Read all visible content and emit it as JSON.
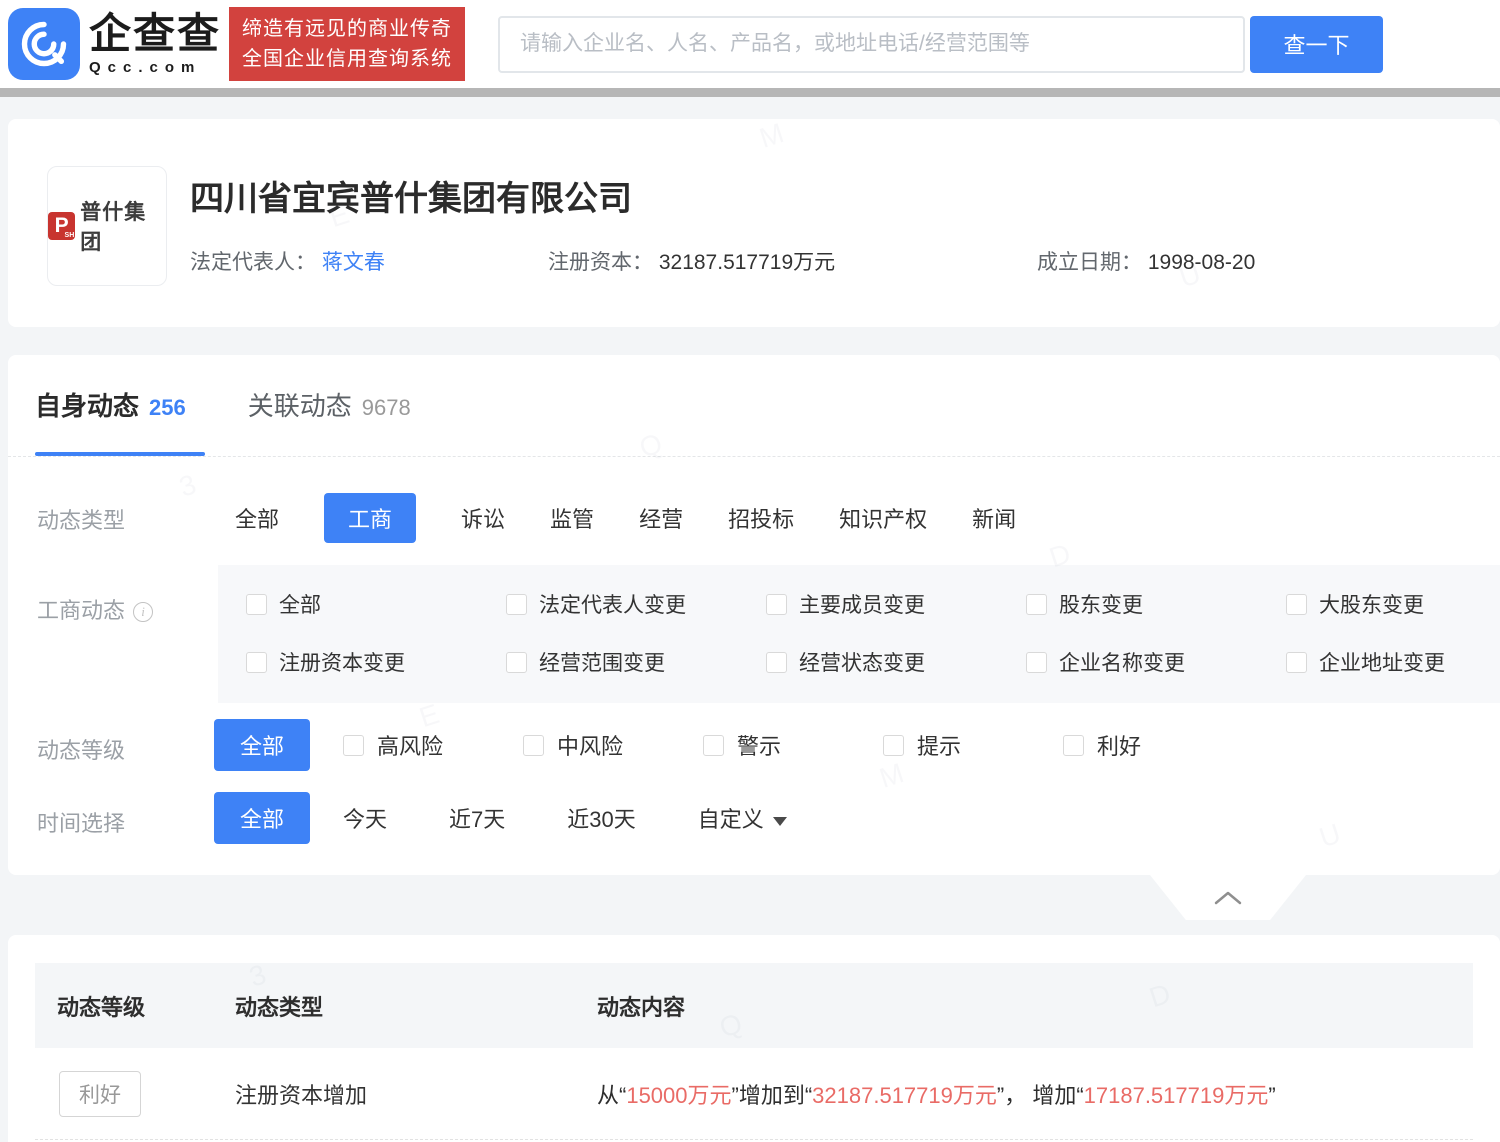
{
  "brand": {
    "name": "企查查",
    "domain": "Qcc.com",
    "slogan_line1": "缔造有远见的商业传奇",
    "slogan_line2": "全国企业信用查询系统"
  },
  "search": {
    "placeholder": "请输入企业名、人名、产品名，或地址电话/经营范围等",
    "button_label": "查一下"
  },
  "company": {
    "logo_letter": "P",
    "logo_sub": "SH",
    "logo_text": "普什集团",
    "name": "四川省宜宾普什集团有限公司",
    "legal_rep_label": "法定代表人：",
    "legal_rep": "蒋文春",
    "reg_capital_label": "注册资本：",
    "reg_capital": "32187.517719万元",
    "established_label": "成立日期：",
    "established": "1998-08-20"
  },
  "tabs": {
    "self": {
      "label": "自身动态",
      "count": "256"
    },
    "related": {
      "label": "关联动态",
      "count": "9678"
    }
  },
  "filters": {
    "type": {
      "label": "动态类型",
      "options": [
        "全部",
        "工商",
        "诉讼",
        "监管",
        "经营",
        "招投标",
        "知识产权",
        "新闻"
      ],
      "selected": "工商"
    },
    "biz_changes": {
      "label": "工商动态",
      "row1": [
        "全部",
        "法定代表人变更",
        "主要成员变更",
        "股东变更",
        "大股东变更"
      ],
      "row2": [
        "注册资本变更",
        "经营范围变更",
        "经营状态变更",
        "企业名称变更",
        "企业地址变更"
      ]
    },
    "level": {
      "label": "动态等级",
      "all_label": "全部",
      "options": [
        "高风险",
        "中风险",
        "警示",
        "提示",
        "利好"
      ]
    },
    "time": {
      "label": "时间选择",
      "all_label": "全部",
      "options": [
        "今天",
        "近7天",
        "近30天"
      ],
      "custom_label": "自定义"
    }
  },
  "table": {
    "headers": [
      "动态等级",
      "动态类型",
      "动态内容"
    ],
    "rows": [
      {
        "level": "利好",
        "type": "注册资本增加",
        "content_parts": [
          {
            "text": "从“"
          },
          {
            "text": "15000万元"
          },
          {
            "text": "”增加到“"
          },
          {
            "text": "32187.517719万元"
          },
          {
            "text": "”， 增加“"
          },
          {
            "text": "17187.517719万元"
          },
          {
            "text": "”"
          }
        ]
      }
    ]
  },
  "watermark": {
    "glyphs": [
      "E",
      "M",
      "U",
      "3",
      "Q",
      "D",
      "E",
      "M",
      "U",
      "3",
      "Q",
      "D"
    ]
  },
  "colors": {
    "accent_blue": "#3E82F6",
    "brand_red": "#D2423E",
    "highlight_red": "#E96B66"
  }
}
